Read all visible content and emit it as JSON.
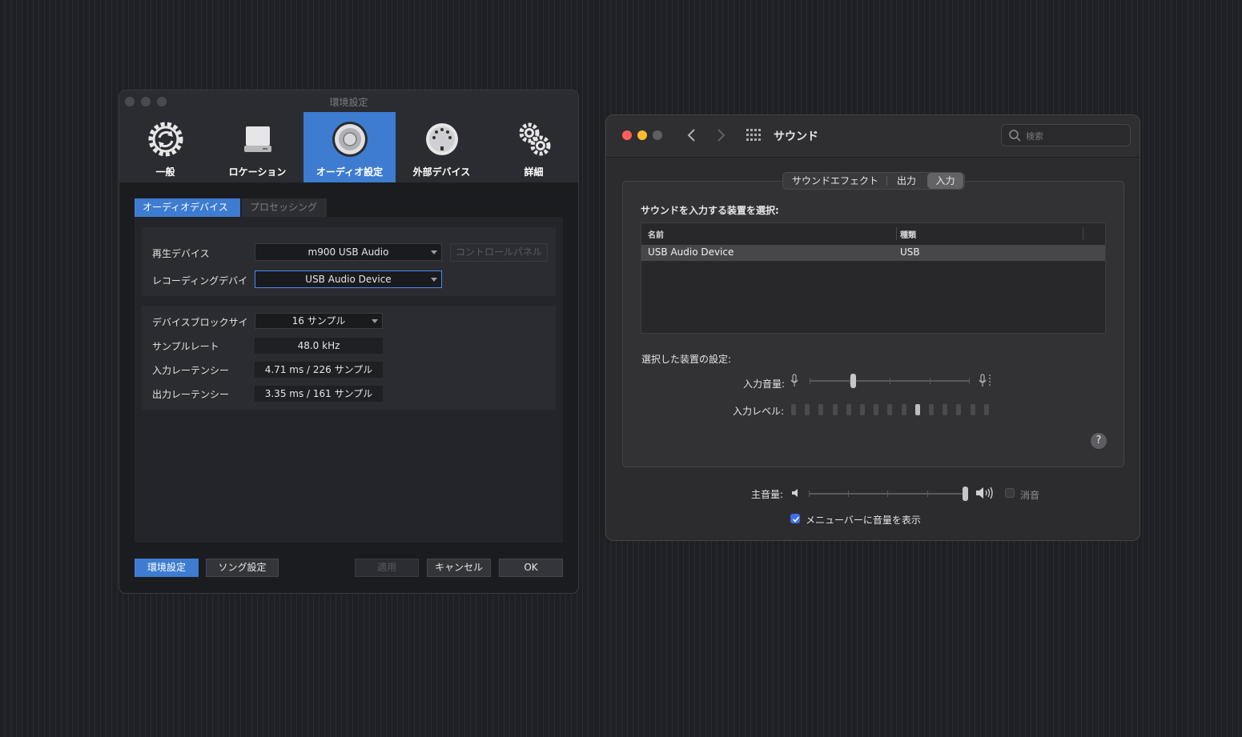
{
  "left_window": {
    "title": "環境設定",
    "toolbar": [
      {
        "label": "一般",
        "icon": "sync-gear-icon"
      },
      {
        "label": "ロケーション",
        "icon": "drive-icon"
      },
      {
        "label": "オーディオ設定",
        "icon": "speaker-icon"
      },
      {
        "label": "外部デバイス",
        "icon": "midi-port-icon"
      },
      {
        "label": "詳細",
        "icon": "gears-icon"
      }
    ],
    "active_tool": "オーディオ設定",
    "tabs": [
      "オーディオデバイス",
      "プロセッシング"
    ],
    "device": {
      "playback_label": "再生デバイス",
      "playback_value": "m900 USB Audio",
      "control_panel": "コントロールパネル",
      "recording_label": "レコーディングデバイ",
      "recording_value": "USB Audio Device"
    },
    "settings": {
      "block_label": "デバイスブロックサイ",
      "block_value": "16 サンプル",
      "rate_label": "サンプルレート",
      "rate_value": "48.0 kHz",
      "in_lat_label": "入力レーテンシー",
      "in_lat_value": "4.71 ms / 226 サンプル",
      "out_lat_label": "出力レーテンシー",
      "out_lat_value": "3.35 ms / 161 サンプル"
    },
    "buttons": {
      "env": "環境設定",
      "song": "ソング設定",
      "apply": "適用",
      "cancel": "キャンセル",
      "ok": "OK"
    }
  },
  "right_window": {
    "title": "サウンド",
    "search_placeholder": "検索",
    "tabs": [
      "サウンドエフェクト",
      "出力",
      "入力"
    ],
    "active_tab": "入力",
    "select_heading": "サウンドを入力する装置を選択:",
    "table": {
      "headers": [
        "名前",
        "種類"
      ],
      "rows": [
        [
          "USB Audio Device",
          "USB"
        ]
      ]
    },
    "settings_heading": "選択した装置の設定:",
    "input_volume_label": "入力音量:",
    "input_volume_level": 0.27,
    "input_level_label": "入力レベル:",
    "input_level_active_segment": 9,
    "input_level_segments": 15,
    "help": "?",
    "main_volume_label": "主音量:",
    "main_volume_level": 0.99,
    "mute_label": "消音",
    "mute_checked": false,
    "menubar_label": "メニューバーに音量を表示",
    "menubar_checked": true,
    "colors": {
      "close": "#ff5f57",
      "minimize": "#febc2e",
      "zoom": "#5f5f61",
      "accent": "#3d7cd0"
    }
  }
}
